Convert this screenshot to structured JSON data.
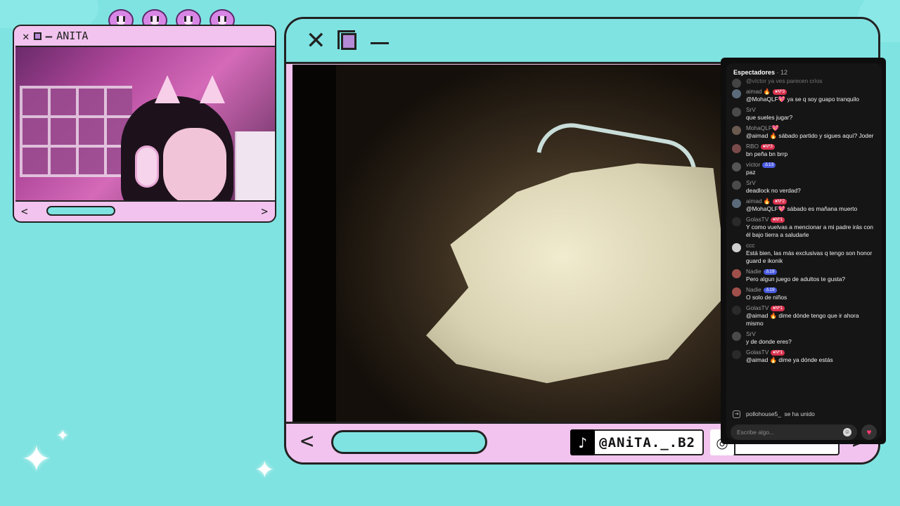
{
  "camera_window": {
    "title": "ANITA",
    "controls": {
      "close": "✕",
      "minimize": "—"
    },
    "nav_left": "<",
    "nav_right": ">"
  },
  "main_window": {
    "controls": {
      "close": "✕",
      "minimize": "—"
    },
    "nav_left": "<",
    "nav_right": ">",
    "socials": [
      {
        "platform": "tiktok",
        "icon": "♪",
        "handle": "@ANiTA._.B2"
      },
      {
        "platform": "instagram",
        "icon": "◎",
        "handle": ""
      }
    ]
  },
  "chat": {
    "header": "Espectadores",
    "viewer_count": "· 12",
    "messages": [
      {
        "user": "",
        "tag": "",
        "tag_style": "",
        "text": "@víctor ya ves parecen críos",
        "faded": true,
        "avatar_color": "#444444"
      },
      {
        "user": "aimad 🔥",
        "tag": "♦Nº3",
        "tag_style": "red",
        "text": "@MohaQLF💖 ya se q soy guapo tranquilo",
        "faded": false,
        "avatar_color": "#5a6a7a"
      },
      {
        "user": "SrV",
        "tag": "",
        "tag_style": "",
        "text": "que sueles jugar?",
        "faded": false,
        "avatar_color": "#4a4a4a"
      },
      {
        "user": "MohaQLF💖",
        "tag": "",
        "tag_style": "",
        "text": "@aimad 🔥 sábado partido y sigues aquí? Joder",
        "faded": false,
        "avatar_color": "#6a5a50"
      },
      {
        "user": "RBO",
        "tag": "♦Nº3",
        "tag_style": "red",
        "text": "bn peña bn brrp",
        "faded": false,
        "avatar_color": "#7a4a4a"
      },
      {
        "user": "víctor",
        "tag": "♙13",
        "tag_style": "blue",
        "text": "paz",
        "faded": false,
        "avatar_color": "#555555"
      },
      {
        "user": "SrV",
        "tag": "",
        "tag_style": "",
        "text": "deadlock no verdad?",
        "faded": false,
        "avatar_color": "#4a4a4a"
      },
      {
        "user": "aimad 🔥",
        "tag": "♦Nº2",
        "tag_style": "red",
        "text": "@MohaQLF💖 sábado es mañana muerto",
        "faded": false,
        "avatar_color": "#5a6a7a"
      },
      {
        "user": "GolasTV",
        "tag": "♦Nº1",
        "tag_style": "red",
        "text": "Y como vuelvas a mencionar a mi padre irás con él bajo tierra a saludarle",
        "faded": false,
        "avatar_color": "#2a2a2a"
      },
      {
        "user": "ccc",
        "tag": "",
        "tag_style": "",
        "text": "Está bien, las más exclusivas q tengo son honor guard e ikonik",
        "faded": false,
        "avatar_color": "#cfcfcf"
      },
      {
        "user": "Nadie",
        "tag": "♙19",
        "tag_style": "blue",
        "text": "Pero algun juego de adultos te gusta?",
        "faded": false,
        "avatar_color": "#a0504a"
      },
      {
        "user": "Nadie",
        "tag": "♙19",
        "tag_style": "blue",
        "text": "O solo de niños",
        "faded": false,
        "avatar_color": "#a0504a"
      },
      {
        "user": "GolasTV",
        "tag": "♦Nº1",
        "tag_style": "red",
        "text": "@aimad 🔥 dime dónde tengo que ir ahora mismo",
        "faded": false,
        "avatar_color": "#2a2a2a"
      },
      {
        "user": "SrV",
        "tag": "",
        "tag_style": "",
        "text": "y de donde eres?",
        "faded": false,
        "avatar_color": "#4a4a4a"
      },
      {
        "user": "GolasTV",
        "tag": "♦Nº1",
        "tag_style": "red",
        "text": "@aimad 🔥 dime ya dónde estás",
        "faded": false,
        "avatar_color": "#2a2a2a"
      }
    ],
    "joined": {
      "user": "pollohouse5_",
      "text": "se ha unido"
    },
    "input_placeholder": "Escribe algo...",
    "heart_icon": "♥",
    "emoji_icon": "☺"
  },
  "colors": {
    "background": "#7fe3e1",
    "window_pink": "#f2c3ef",
    "outline": "#222222",
    "tag_red": "#d9324f",
    "tag_blue": "#4a5be0"
  }
}
